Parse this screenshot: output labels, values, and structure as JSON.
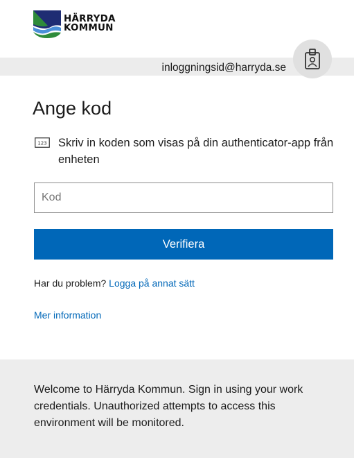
{
  "brand": {
    "line1": "HÄRRYDA",
    "line2": "KOMMUN",
    "colors": {
      "green": "#2e7d32",
      "navy": "#1f2d73",
      "water": "#4a90d9"
    }
  },
  "identity": {
    "email": "inloggningsid@harryda.se",
    "badge_icon": "id-badge-icon"
  },
  "page": {
    "title": "Ange kod",
    "description_icon": "numeric-keypad-123-icon",
    "description_icon_text": "123",
    "description": "Skriv in koden som visas på din authenticator-app från enheten"
  },
  "code_input": {
    "placeholder": "Kod",
    "value": ""
  },
  "verify_button": {
    "label": "Verifiera"
  },
  "help": {
    "question": "Har du problem?",
    "alt_link": "Logga på annat sätt",
    "more_info": "Mer information"
  },
  "footer": {
    "message": "Welcome to Härryda Kommun. Sign in using your work credentials. Unauthorized attempts to access this environment will be monitored."
  },
  "theme": {
    "accent": "#0067b8",
    "band": "#ececec"
  }
}
